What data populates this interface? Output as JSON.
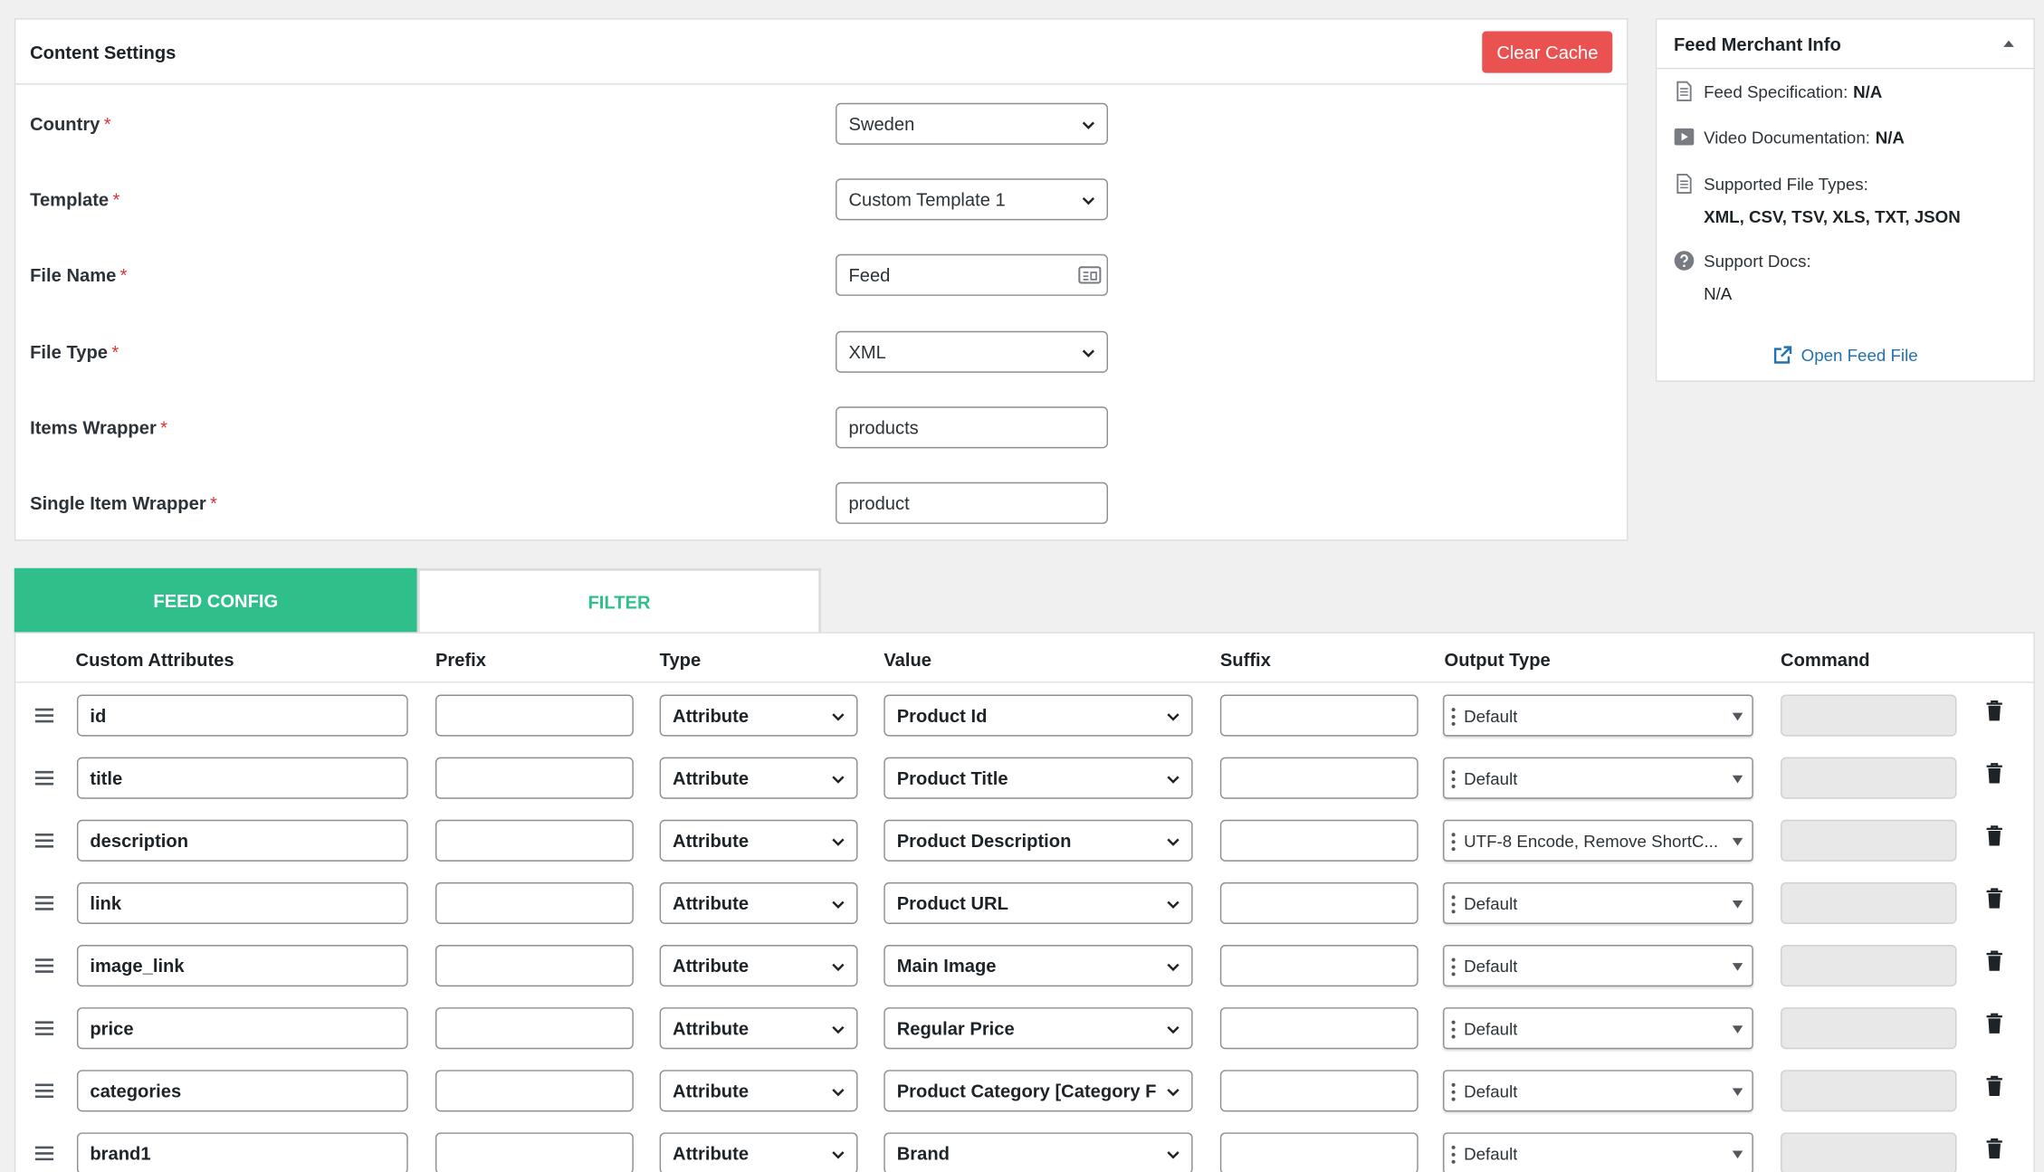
{
  "content_settings": {
    "title": "Content Settings",
    "clear_cache_label": "Clear Cache",
    "required_mark": "*",
    "fields": [
      {
        "label": "Country",
        "value": "Sweden",
        "kind": "select"
      },
      {
        "label": "Template",
        "value": "Custom Template 1",
        "kind": "select"
      },
      {
        "label": "File Name",
        "value": "Feed",
        "kind": "text-card"
      },
      {
        "label": "File Type",
        "value": "XML",
        "kind": "select"
      },
      {
        "label": "Items Wrapper",
        "value": "products",
        "kind": "text"
      },
      {
        "label": "Single Item Wrapper",
        "value": "product",
        "kind": "text"
      }
    ]
  },
  "merchant_info": {
    "title": "Feed Merchant Info",
    "feed_spec_label": "Feed Specification:",
    "feed_spec_value": "N/A",
    "video_doc_label": "Video Documentation:",
    "video_doc_value": "N/A",
    "file_types_label": "Supported File Types:",
    "file_types_value": "XML, CSV, TSV, XLS, TXT, JSON",
    "support_docs_label": "Support Docs:",
    "support_docs_value": "N/A",
    "open_feed_label": "Open Feed File"
  },
  "tabs": [
    {
      "label": "FEED CONFIG",
      "active": true
    },
    {
      "label": "FILTER",
      "active": false
    }
  ],
  "table": {
    "headers": {
      "custom_attributes": "Custom Attributes",
      "prefix": "Prefix",
      "type": "Type",
      "value": "Value",
      "suffix": "Suffix",
      "output_type": "Output Type",
      "command": "Command"
    },
    "rows": [
      {
        "attribute": "id",
        "prefix": "",
        "type": "Attribute",
        "value": "Product Id",
        "suffix": "",
        "output": "Default"
      },
      {
        "attribute": "title",
        "prefix": "",
        "type": "Attribute",
        "value": "Product Title",
        "suffix": "",
        "output": "Default"
      },
      {
        "attribute": "description",
        "prefix": "",
        "type": "Attribute",
        "value": "Product Description",
        "suffix": "",
        "output": "UTF-8 Encode, Remove ShortC..."
      },
      {
        "attribute": "link",
        "prefix": "",
        "type": "Attribute",
        "value": "Product URL",
        "suffix": "",
        "output": "Default"
      },
      {
        "attribute": "image_link",
        "prefix": "",
        "type": "Attribute",
        "value": "Main Image",
        "suffix": "",
        "output": "Default"
      },
      {
        "attribute": "price",
        "prefix": "",
        "type": "Attribute",
        "value": "Regular Price",
        "suffix": "",
        "output": "Default"
      },
      {
        "attribute": "categories",
        "prefix": "",
        "type": "Attribute",
        "value": "Product Category [Category F",
        "suffix": "",
        "output": "Default"
      },
      {
        "attribute": "brand1",
        "prefix": "",
        "type": "Attribute",
        "value": "Brand",
        "suffix": "",
        "output": "Default"
      }
    ]
  },
  "colors": {
    "accent_green": "#2ebf8b",
    "danger_red": "#ea5252",
    "link_blue": "#2271b1",
    "required_red": "#d63638"
  },
  "icons": [
    "chevron-down-icon",
    "card-icon",
    "document-icon",
    "video-icon",
    "help-icon",
    "external-link-icon",
    "drag-handle-icon",
    "trash-icon",
    "dots-icon",
    "triangle-up-icon"
  ]
}
